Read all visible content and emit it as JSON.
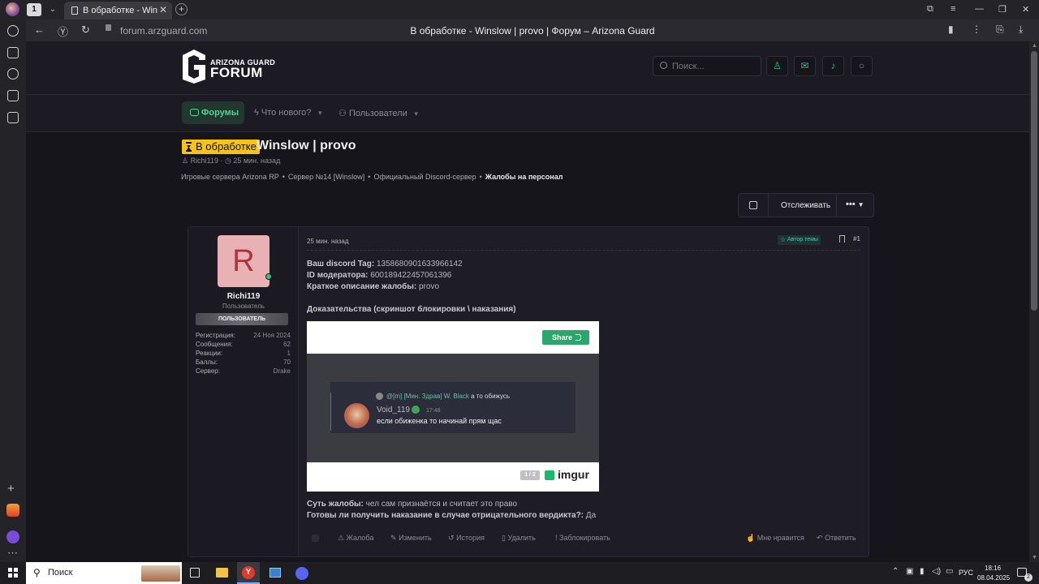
{
  "browser": {
    "tab_count": "1",
    "tab_title": "В обработке - Winslow | provo | Форум – Arizona Guard",
    "url": "forum.arzguard.com",
    "page_title": "В обработке - Winslow | provo | Форум – Arizona Guard"
  },
  "header": {
    "logo_top": "ARIZONA GUARD",
    "logo_bottom": "FORUM",
    "search_placeholder": "Поиск..."
  },
  "nav": {
    "forums": "Форумы",
    "whats_new": "Что нового?",
    "users": "Пользователи"
  },
  "thread": {
    "status": "В обработке",
    "title": "Winslow | provo",
    "author": "Richi119",
    "time": "25 мин. назад",
    "breadcrumb": [
      "Игровые сервера Arizona RP",
      "Сервер №14 [Winslow]",
      "Официальный Discord-сервер",
      "Жалобы на персонал"
    ]
  },
  "actions": {
    "follow": "Отслеживать",
    "more": "•••"
  },
  "post": {
    "user": {
      "avatar_letter": "R",
      "name": "Richi119",
      "title": "Пользователь",
      "banner": "ПОЛЬЗОВАТЕЛЬ",
      "stats": [
        {
          "label": "Регистрация:",
          "value": "24 Ноя 2024"
        },
        {
          "label": "Сообщения:",
          "value": "62"
        },
        {
          "label": "Реакции:",
          "value": "1"
        },
        {
          "label": "Баллы:",
          "value": "70"
        },
        {
          "label": "Сервер:",
          "value": "Drake"
        }
      ]
    },
    "time": "25 мин. назад",
    "author_badge": "Автор темы",
    "number": "#1",
    "fields": [
      {
        "label": "Ваш discord Tag:",
        "value": "1358680901633966142"
      },
      {
        "label": "ID модератора:",
        "value": "600189422457061396"
      },
      {
        "label": "Краткое описание жалобы:",
        "value": "provo"
      }
    ],
    "evidence_title": "Доказательства (скриншот блокировки \\ наказания)",
    "imgur": {
      "share": "Share",
      "pager": "1 / 2",
      "logo": "imgur",
      "discord_reply_mention": "@[m] [Мин. Здрав] W. Black",
      "discord_reply_text": "а то обижусь",
      "discord_name": "Void_119",
      "discord_time": "17:48",
      "discord_text": "если обиженка то начинай прям щас"
    },
    "fields2": [
      {
        "label": "Суть жалобы:",
        "value": "чел сам признаётся и считает это право"
      },
      {
        "label": "Готовы ли получить наказание в случае отрицательного вердикта?:",
        "value": "Да"
      }
    ],
    "footer": {
      "report": "Жалоба",
      "edit": "Изменить",
      "history": "История",
      "delete": "Удалить",
      "block": "Заблокировать",
      "like": "Мне нравится",
      "reply": "Ответить"
    }
  },
  "taskbar": {
    "search": "Поиск",
    "lang": "РУС",
    "time": "18:16",
    "date": "08.04.2025",
    "notif_count": "2"
  },
  "colors": {
    "accent": "#2fbf85",
    "status_yellow": "#f7c415",
    "background": "#16151c"
  }
}
